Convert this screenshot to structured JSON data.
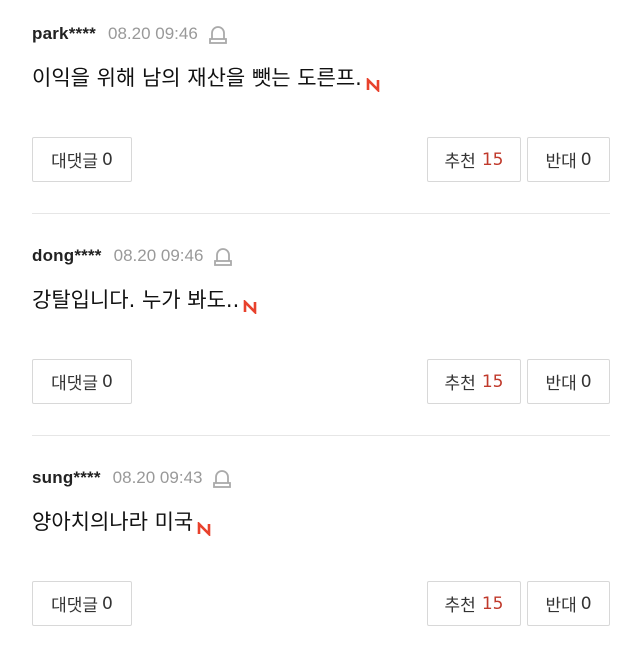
{
  "comments": [
    {
      "user": "park****",
      "time": "08.20 09:46",
      "text": "이익을 위해 남의 재산을 뺏는 도른프.",
      "reply_label": "대댓글",
      "reply_count": "0",
      "recommend_label": "추천",
      "recommend_count": "15",
      "oppose_label": "반대",
      "oppose_count": "0"
    },
    {
      "user": "dong****",
      "time": "08.20 09:46",
      "text": "강탈입니다. 누가 봐도..",
      "reply_label": "대댓글",
      "reply_count": "0",
      "recommend_label": "추천",
      "recommend_count": "15",
      "oppose_label": "반대",
      "oppose_count": "0"
    },
    {
      "user": "sung****",
      "time": "08.20 09:43",
      "text": "양아치의나라 미국",
      "reply_label": "대댓글",
      "reply_count": "0",
      "recommend_label": "추천",
      "recommend_count": "15",
      "oppose_label": "반대",
      "oppose_count": "0"
    }
  ],
  "icons": {
    "report": "report-siren-icon",
    "new_badge": "new-badge-icon"
  },
  "colors": {
    "accent_red": "#c0392b",
    "time_gray": "#999999",
    "border": "#d8d8d8"
  }
}
